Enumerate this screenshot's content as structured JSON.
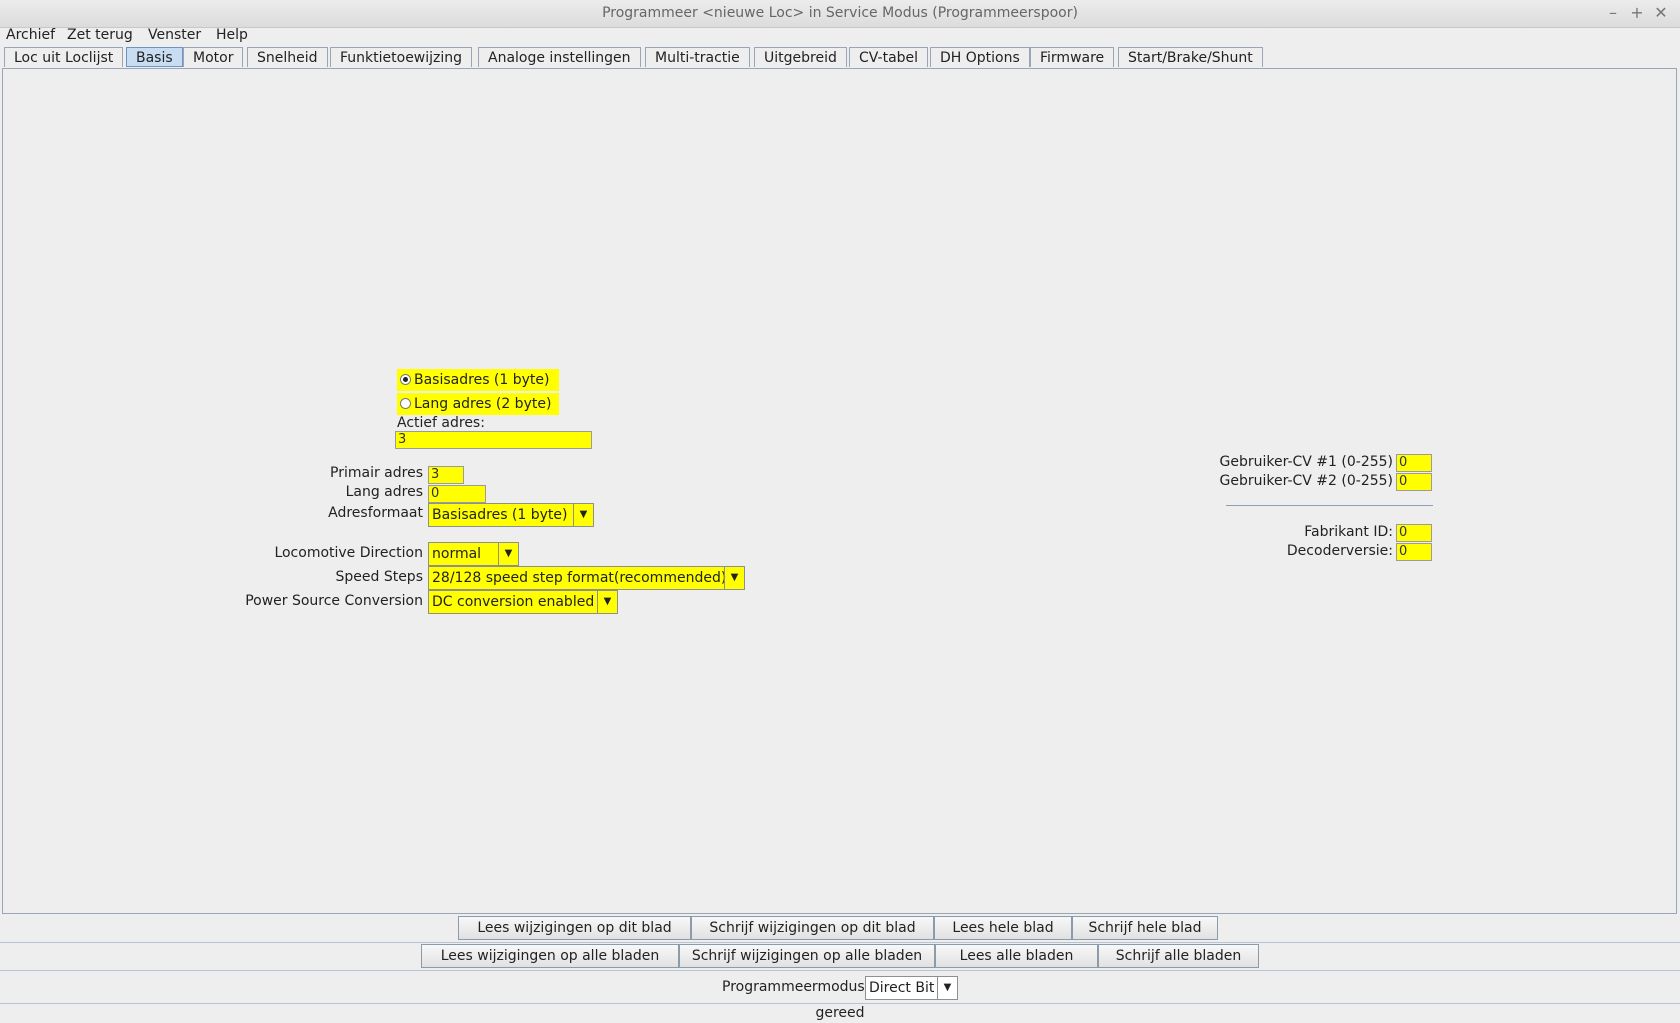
{
  "window": {
    "title": "Programmeer <nieuwe Loc> in Service Modus (Programmeerspoor)",
    "controls": [
      "–",
      "+",
      "✕"
    ]
  },
  "menu": [
    "Archief",
    "Zet terug",
    "Venster",
    "Help"
  ],
  "tabs": [
    "Loc uit Loclijst",
    "Basis",
    "Motor",
    "Snelheid",
    "Funktietoewijzing",
    "Analoge instellingen",
    "Multi-tractie",
    "Uitgebreid",
    "CV-tabel",
    "DH Options",
    "Firmware",
    "Start/Brake/Shunt"
  ],
  "selected_tab": "Basis",
  "basis": {
    "radio_short": "Basisadres (1 byte)",
    "radio_long": "Lang adres (2 byte)",
    "radio_selected": "Basisadres (1 byte)",
    "active_address_label": "Actief adres:",
    "active_address_value": "3",
    "primary_address_label": "Primair adres",
    "primary_address_value": "3",
    "long_address_label": "Lang adres",
    "long_address_value": "0",
    "address_format_label": "Adresformaat",
    "address_format_value": "Basisadres (1 byte)",
    "direction_label": "Locomotive Direction",
    "direction_value": "normal",
    "speed_steps_label": "Speed Steps",
    "speed_steps_value": "28/128 speed step format(recommended)",
    "power_source_label": "Power Source Conversion",
    "power_source_value": "DC conversion enabled",
    "user_cv1_label": "Gebruiker-CV #1 (0-255)",
    "user_cv1_value": "0",
    "user_cv2_label": "Gebruiker-CV #2 (0-255)",
    "user_cv2_value": "0",
    "manufacturer_label": "Fabrikant ID:",
    "manufacturer_value": "0",
    "decoder_version_label": "Decoderversie:",
    "decoder_version_value": "0"
  },
  "buttons_row1": [
    "Lees wijzigingen op dit blad",
    "Schrijf wijzigingen op dit blad",
    "Lees hele blad",
    "Schrijf hele blad"
  ],
  "buttons_row2": [
    "Lees wijzigingen op alle bladen",
    "Schrijf wijzigingen op alle bladen",
    "Lees alle bladen",
    "Schrijf alle bladen"
  ],
  "mode": {
    "label": "Programmeermodus",
    "value": "Direct Bit"
  },
  "status": "gereed",
  "colors": {
    "field": "#ffff00",
    "selected_tab": "#c8ddf2",
    "background": "#eeeeee"
  },
  "icons": {
    "dropdown": "chevron-down-icon",
    "radio": "radio-icon"
  }
}
